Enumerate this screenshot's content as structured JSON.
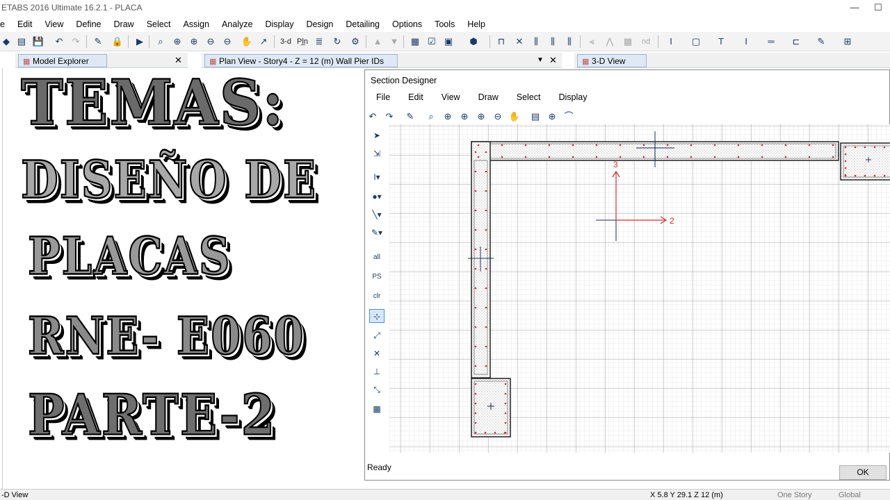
{
  "app": {
    "title": "ETABS 2016 Ultimate 16.2.1 - PLACA"
  },
  "window_buttons": [
    "—",
    "☐"
  ],
  "menu": [
    "e",
    "Edit",
    "View",
    "Define",
    "Draw",
    "Select",
    "Assign",
    "Analyze",
    "Display",
    "Design",
    "Detailing",
    "Options",
    "Tools",
    "Help"
  ],
  "toolbar": {
    "view3d_label": "3-d",
    "plan_label": "Pl̲n",
    "nd_label": "nd"
  },
  "tabs": {
    "model_explorer": "Model Explorer",
    "plan_view": "Plan View - Story4 - Z = 12 (m)  Wall Pier IDs",
    "view_3d": "3-D View",
    "close": "✕",
    "dropdown": "▼"
  },
  "overlay_text": {
    "line1": "TEMAS:",
    "line2": "DISEÑO DE",
    "line3": "PLACAS",
    "line4": "RNE- E060",
    "line5": "PARTE-2"
  },
  "section_designer": {
    "title": "Section Designer",
    "menu": [
      "File",
      "Edit",
      "View",
      "Draw",
      "Select",
      "Display"
    ],
    "side_tools": {
      "all": "all",
      "ps": "PS",
      "clr": "clr"
    },
    "axis_3": "3",
    "axis_2": "2",
    "status": "Ready",
    "ok_label": "OK"
  },
  "statusbar": {
    "left": "-D View",
    "coords": "X 5.8  Y 29.1  Z 12 (m)",
    "story": "One Story",
    "global": "Global"
  }
}
